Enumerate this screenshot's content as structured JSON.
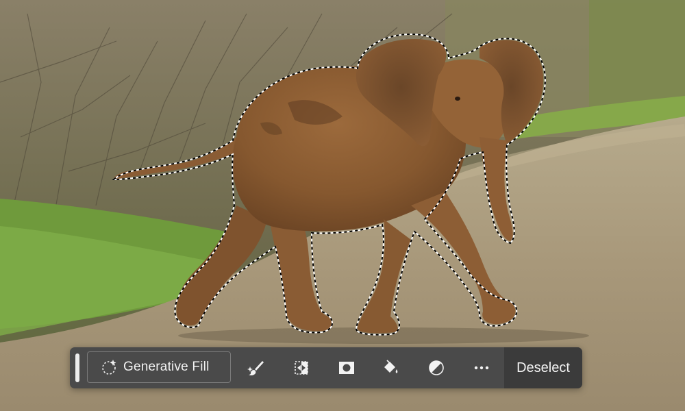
{
  "canvas": {
    "subject": "elephant-calf-photo",
    "selection": "marching-ants-selection"
  },
  "taskbar": {
    "generative_fill_label": "Generative Fill",
    "tools": [
      {
        "icon": "select-subject-brush-icon"
      },
      {
        "icon": "transform-selection-icon"
      },
      {
        "icon": "create-mask-icon"
      },
      {
        "icon": "fill-selection-icon"
      },
      {
        "icon": "adjustment-layer-icon"
      },
      {
        "icon": "more-options-icon"
      }
    ],
    "deselect_label": "Deselect"
  },
  "colors": {
    "taskbar_bg": "#4a4a4a",
    "deselect_bg": "#3b3b3b",
    "text": "#f3f3f3"
  }
}
